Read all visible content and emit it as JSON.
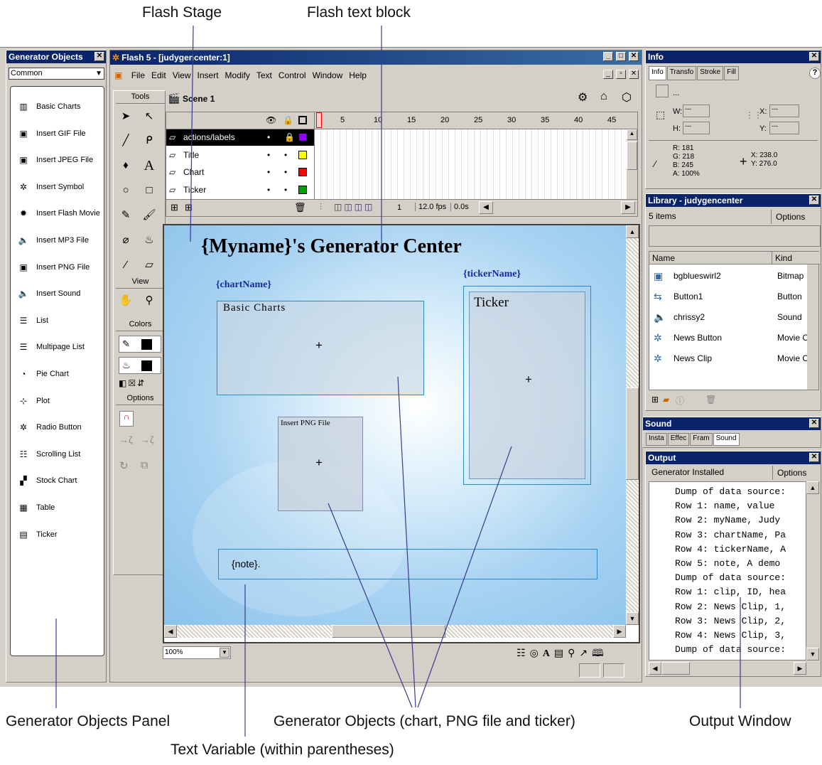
{
  "callouts": {
    "flash_stage": "Flash Stage",
    "flash_text_block": "Flash text block",
    "generator_objects_panel": "Generator Objects Panel",
    "generator_objects": "Generator Objects (chart, PNG file and ticker)",
    "output_window": "Output Window",
    "text_variable": "Text Variable (within parentheses)"
  },
  "gen_panel": {
    "title": "Generator Objects",
    "dropdown": "Common",
    "items": [
      {
        "label": "Basic Charts",
        "icon": "bar-chart-icon"
      },
      {
        "label": "Insert GIF File",
        "icon": "image-icon"
      },
      {
        "label": "Insert JPEG File",
        "icon": "image-icon"
      },
      {
        "label": "Insert Symbol",
        "icon": "symbol-icon"
      },
      {
        "label": "Insert Flash Movie",
        "icon": "movie-icon"
      },
      {
        "label": "Insert MP3 File",
        "icon": "speaker-icon"
      },
      {
        "label": "Insert PNG File",
        "icon": "image-icon"
      },
      {
        "label": "Insert Sound",
        "icon": "speaker-icon"
      },
      {
        "label": "List",
        "icon": "list-icon"
      },
      {
        "label": "Multipage List",
        "icon": "list-icon"
      },
      {
        "label": "Pie Chart",
        "icon": "pie-chart-icon"
      },
      {
        "label": "Plot",
        "icon": "plot-icon"
      },
      {
        "label": "Radio Button",
        "icon": "radio-icon"
      },
      {
        "label": "Scrolling List",
        "icon": "scroll-list-icon"
      },
      {
        "label": "Stock Chart",
        "icon": "stock-chart-icon"
      },
      {
        "label": "Table",
        "icon": "table-icon"
      },
      {
        "label": "Ticker",
        "icon": "ticker-icon"
      }
    ]
  },
  "window": {
    "title": "Flash 5 - [judygencenter:1]",
    "menus": [
      "File",
      "Edit",
      "View",
      "Insert",
      "Modify",
      "Text",
      "Control",
      "Window",
      "Help"
    ]
  },
  "tools": {
    "header": "Tools",
    "view_header": "View",
    "colors_header": "Colors",
    "options_header": "Options"
  },
  "timeline": {
    "scene": "Scene 1",
    "frame_numbers": [
      "1",
      "5",
      "10",
      "15",
      "20",
      "25",
      "30",
      "35",
      "40",
      "45"
    ],
    "layers": [
      "actions/labels",
      "Title",
      "Chart",
      "Ticker"
    ],
    "layer_colors": [
      "#8b00ff",
      "#ffff00",
      "#ff0000",
      "#00a000"
    ],
    "current_frame": "1",
    "fps": "12.0 fps",
    "time": "0.0s"
  },
  "stage": {
    "heading": "{Myname}'s Generator Center",
    "chart_name": "{chartName}",
    "chart_box_label": "Basic Charts",
    "png_box_label": "Insert PNG File",
    "ticker_name": "{tickerName}",
    "ticker_box_label": "Ticker",
    "note": "{note}.",
    "zoom": "100%"
  },
  "info_panel": {
    "title": "Info",
    "tabs": [
      "Info",
      "Transfo",
      "Stroke",
      "Fill"
    ],
    "ellipsis": "...",
    "w_label": "W:",
    "h_label": "H:",
    "x_label": "X:",
    "y_label": "Y:",
    "field_placeholder": "---",
    "r": "R: 181",
    "g": "G: 218",
    "b": "B: 245",
    "a": "A: 100%",
    "cursor_x": "X:  238.0",
    "cursor_y": "Y:  276.0"
  },
  "library": {
    "title": "Library - judygencenter",
    "count": "5 items",
    "options": "Options",
    "col_name": "Name",
    "col_kind": "Kind",
    "items": [
      {
        "name": "bgblueswirl2",
        "kind": "Bitmap",
        "icon": "bitmap-icon"
      },
      {
        "name": "Button1",
        "kind": "Button",
        "icon": "button-icon"
      },
      {
        "name": "chrissy2",
        "kind": "Sound",
        "icon": "speaker-icon"
      },
      {
        "name": "News Button",
        "kind": "Movie C",
        "icon": "movie-clip-icon"
      },
      {
        "name": "News Clip",
        "kind": "Movie C",
        "icon": "movie-clip-icon"
      }
    ]
  },
  "sound_panel": {
    "title": "Sound",
    "tabs": [
      "Insta",
      "Effec",
      "Fram",
      "Sound"
    ]
  },
  "output": {
    "title": "Output",
    "status": "Generator Installed",
    "options": "Options",
    "lines": [
      "Dump of data source:",
      "Row 1: name, value",
      "Row 2: myName, Judy",
      "Row 3: chartName, Pa",
      "Row 4: tickerName, A",
      "Row 5: note, A demo",
      "Dump of data source:",
      "Row 1: clip, ID, hea",
      "Row 2: News Clip, 1,",
      "Row 3: News Clip, 2,",
      "Row 4: News Clip, 3,",
      "Dump of data source:"
    ]
  }
}
